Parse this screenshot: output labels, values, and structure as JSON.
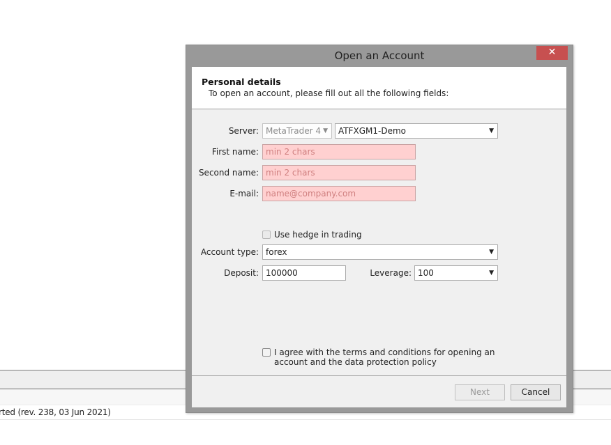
{
  "background": {
    "log_line": "rted (rev. 238, 03 Jun 2021)"
  },
  "dialog": {
    "title": "Open an Account",
    "close_label": "✕",
    "header": {
      "title": "Personal details",
      "subtitle": "To open an account, please fill out all the following fields:"
    },
    "form": {
      "server": {
        "label": "Server:",
        "platform_value": "MetaTrader 4",
        "server_value": "ATFXGM1-Demo"
      },
      "first_name": {
        "label": "First name:",
        "placeholder": "min 2 chars",
        "value": ""
      },
      "second_name": {
        "label": "Second name:",
        "placeholder": "min 2 chars",
        "value": ""
      },
      "email": {
        "label": "E-mail:",
        "placeholder": "name@company.com",
        "value": ""
      },
      "hedge": {
        "label": "Use hedge in trading",
        "checked": false,
        "enabled": false
      },
      "account_type": {
        "label": "Account type:",
        "value": "forex"
      },
      "deposit": {
        "label": "Deposit:",
        "value": "100000"
      },
      "leverage": {
        "label": "Leverage:",
        "value": "100"
      },
      "agree": {
        "line1": "I agree with the terms and conditions for opening an",
        "line2": "account and the data protection policy",
        "checked": false
      }
    },
    "buttons": {
      "next_label": "Next",
      "cancel_label": "Cancel"
    },
    "colors": {
      "invalid_bg": "#ffd0d0",
      "close_bg": "#c75050"
    }
  }
}
